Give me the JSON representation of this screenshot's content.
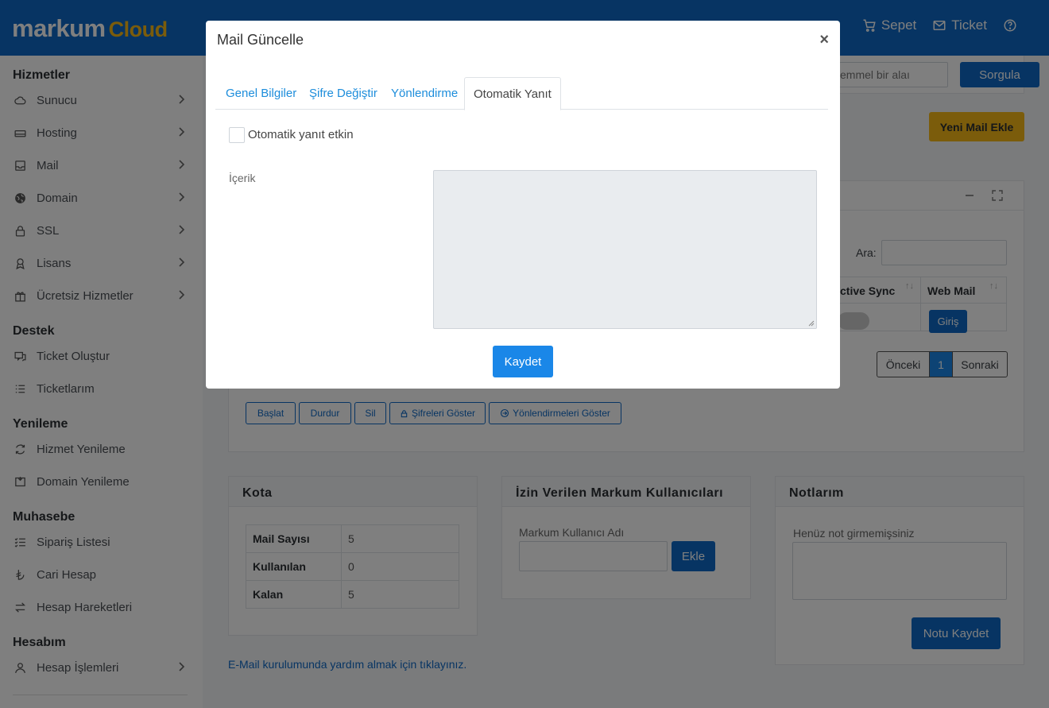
{
  "brand": {
    "part1": "markum",
    "part2": "Cloud"
  },
  "topnav": {
    "cart": "Sepet",
    "ticket": "Ticket"
  },
  "sidebar": {
    "sections": [
      {
        "title": "Hizmetler",
        "items": [
          "Sunucu",
          "Hosting",
          "Mail",
          "Domain",
          "SSL",
          "Lisans",
          "Ücretsiz Hizmetler"
        ]
      },
      {
        "title": "Destek",
        "items": [
          "Ticket Oluştur",
          "Ticketlarım"
        ]
      },
      {
        "title": "Yenileme",
        "items": [
          "Hizmet Yenileme",
          "Domain Yenileme"
        ]
      },
      {
        "title": "Muhasebe",
        "items": [
          "Sipariş Listesi",
          "Cari Hesap",
          "Hesap Hareketleri"
        ]
      },
      {
        "title": "Hesabım",
        "items": [
          "Hesap İşlemleri"
        ]
      }
    ]
  },
  "main": {
    "search_placeholder": "emmel bir alaı",
    "query_button": "Sorgula",
    "new_mail_button": "Yeni Mail Ekle",
    "search_label": "Ara:",
    "table_headers": {
      "active_sync": "ctive Sync",
      "web_mail": "Web Mail"
    },
    "login_button": "Giriş",
    "pagination": {
      "prev": "Önceki",
      "page": "1",
      "next": "Sonraki"
    },
    "actions": [
      "Başlat",
      "Durdur",
      "Sil",
      "Şifreleri Göster",
      "Yönlendirmeleri Göster"
    ],
    "quota": {
      "title": "Kota",
      "rows": [
        {
          "key": "Mail Sayısı",
          "value": "5"
        },
        {
          "key": "Kullanılan",
          "value": "0"
        },
        {
          "key": "Kalan",
          "value": "5"
        }
      ]
    },
    "allowed_users": {
      "title": "İzin Verilen Markum Kullanıcıları",
      "field_label": "Markum Kullanıcı Adı",
      "add_button": "Ekle"
    },
    "notes": {
      "title": "Notlarım",
      "placeholder": "Henüz not girmemişsiniz",
      "save_button": "Notu Kaydet"
    },
    "help_link": "E-Mail kurulumunda yardım almak için tıklayınız."
  },
  "modal": {
    "title": "Mail Güncelle",
    "close": "×",
    "tabs": [
      "Genel Bilgiler",
      "Şifre Değiştir",
      "Yönlendirme",
      "Otomatik Yanıt"
    ],
    "active_tab": "Otomatik Yanıt",
    "auto_reply_label": "Otomatik yanıt etkin",
    "auto_reply_checked": false,
    "content_label": "İçerik",
    "content_value": "",
    "save_button": "Kaydet"
  },
  "colors": {
    "primary": "#0e69c6",
    "accent": "#f6b917",
    "modal_button": "#1a87e8",
    "tab_link": "#1d8ddb"
  }
}
